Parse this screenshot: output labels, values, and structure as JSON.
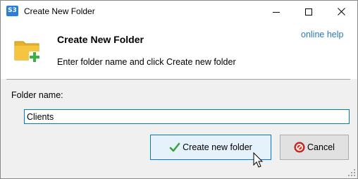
{
  "window": {
    "app_icon_text": "S3",
    "title": "Create New Folder"
  },
  "header": {
    "title": "Create New Folder",
    "subtitle": "Enter folder name and click Create new folder",
    "help_link": "online help",
    "icon": "folder-add-icon"
  },
  "form": {
    "label": "Folder name:",
    "value": "Clients"
  },
  "buttons": {
    "create_label": "Create new folder",
    "create_icon": "checkmark-icon",
    "cancel_label": "Cancel",
    "cancel_icon": "stop-icon"
  },
  "colors": {
    "accent": "#0078d7",
    "link": "#2a7ab5",
    "folder": "#f5c542",
    "plus": "#3cb043"
  }
}
